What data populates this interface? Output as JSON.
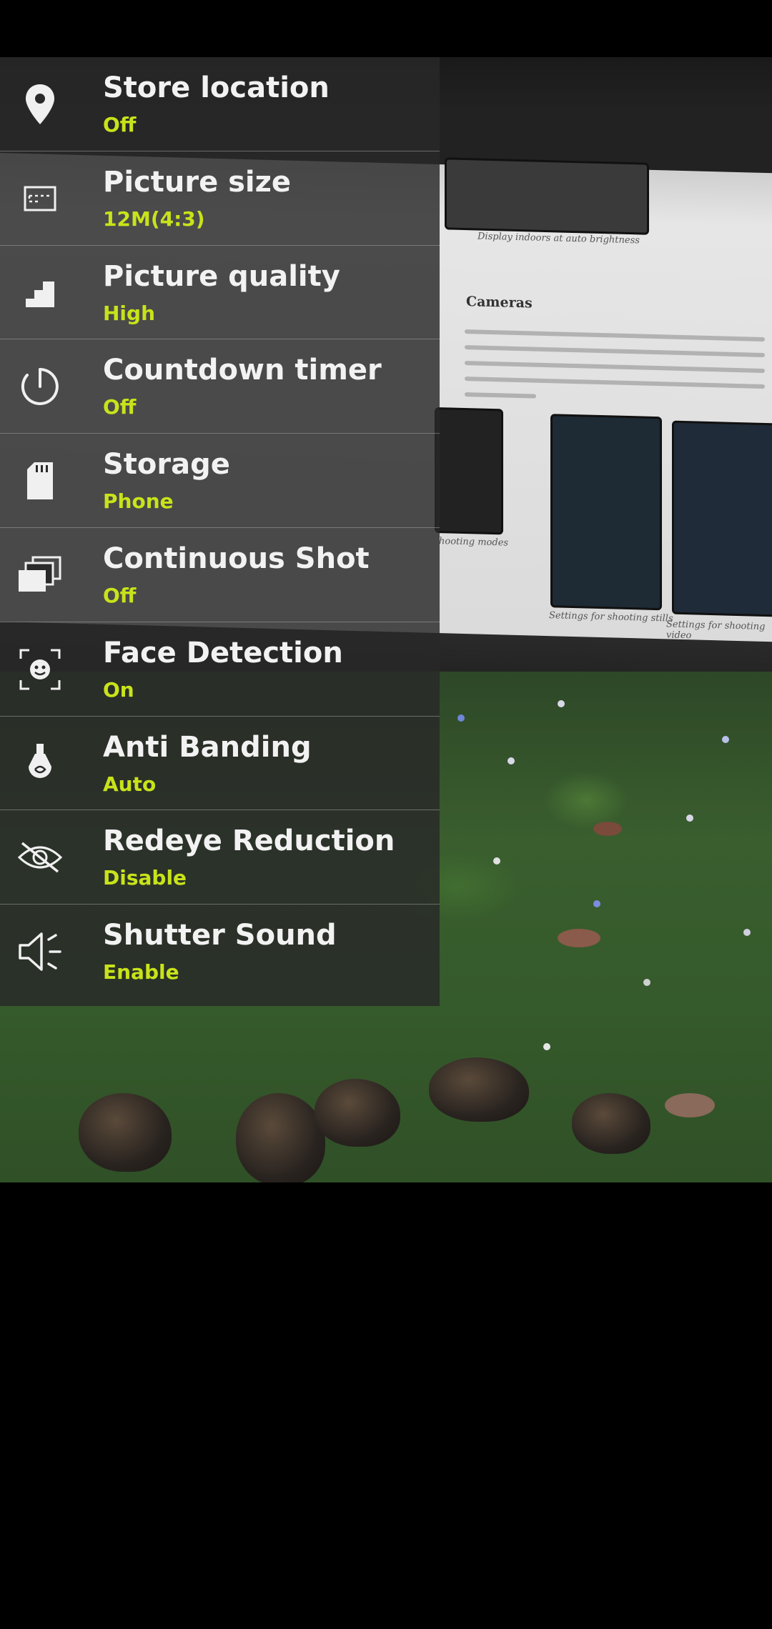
{
  "settings": {
    "items": [
      {
        "icon": "location-pin-icon",
        "label": "Store location",
        "value": "Off"
      },
      {
        "icon": "picture-size-icon",
        "label": "Picture size",
        "value": "12M(4:3)"
      },
      {
        "icon": "picture-quality-icon",
        "label": "Picture quality",
        "value": "High"
      },
      {
        "icon": "countdown-timer-icon",
        "label": "Countdown timer",
        "value": "Off"
      },
      {
        "icon": "sd-card-icon",
        "label": "Storage",
        "value": "Phone"
      },
      {
        "icon": "continuous-shot-icon",
        "label": "Continuous Shot",
        "value": "Off"
      },
      {
        "icon": "face-detection-icon",
        "label": "Face Detection",
        "value": "On"
      },
      {
        "icon": "anti-banding-bulb-icon",
        "label": "Anti Banding",
        "value": "Auto"
      },
      {
        "icon": "redeye-eye-icon",
        "label": "Redeye Reduction",
        "value": "Disable"
      },
      {
        "icon": "speaker-icon",
        "label": "Shutter Sound",
        "value": "Enable"
      }
    ]
  },
  "viewfinder": {
    "doc_heading": "Cameras",
    "doc_caption_top": "Display indoors at auto brightness",
    "doc_caption_left": "hooting modes",
    "doc_caption_mid": "Settings for shooting stills",
    "doc_caption_right": "Settings for shooting video"
  },
  "colors": {
    "value_accent": "#c8e31a",
    "title_text": "#f2f2f2",
    "panel_bg": "rgba(40,40,40,0.82)"
  }
}
